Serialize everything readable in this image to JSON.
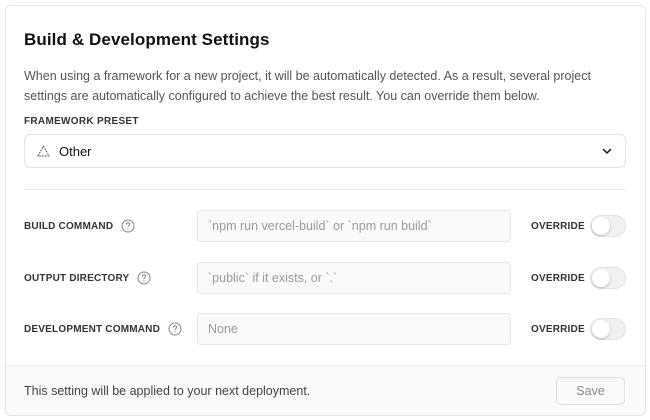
{
  "section": {
    "title": "Build & Development Settings",
    "description": "When using a framework for a new project, it will be automatically detected. As a result, several project settings are automatically configured to achieve the best result. You can override them below."
  },
  "framework_preset": {
    "label": "FRAMEWORK PRESET",
    "selected": "Other",
    "icon": "triangle-warning-icon"
  },
  "fields": [
    {
      "label": "BUILD COMMAND",
      "placeholder": "`npm run vercel-build` or `npm run build`",
      "value": "",
      "override_label": "OVERRIDE",
      "override_enabled": false
    },
    {
      "label": "OUTPUT DIRECTORY",
      "placeholder": "`public` if it exists, or `.`",
      "value": "",
      "override_label": "OVERRIDE",
      "override_enabled": false
    },
    {
      "label": "DEVELOPMENT COMMAND",
      "placeholder": "None",
      "value": "",
      "override_label": "OVERRIDE",
      "override_enabled": false
    }
  ],
  "footer": {
    "note": "This setting will be applied to your next deployment.",
    "save_label": "Save"
  },
  "colors": {
    "border": "#e6e6e6",
    "footer_bg": "#fafafa",
    "muted_text": "#555555"
  }
}
